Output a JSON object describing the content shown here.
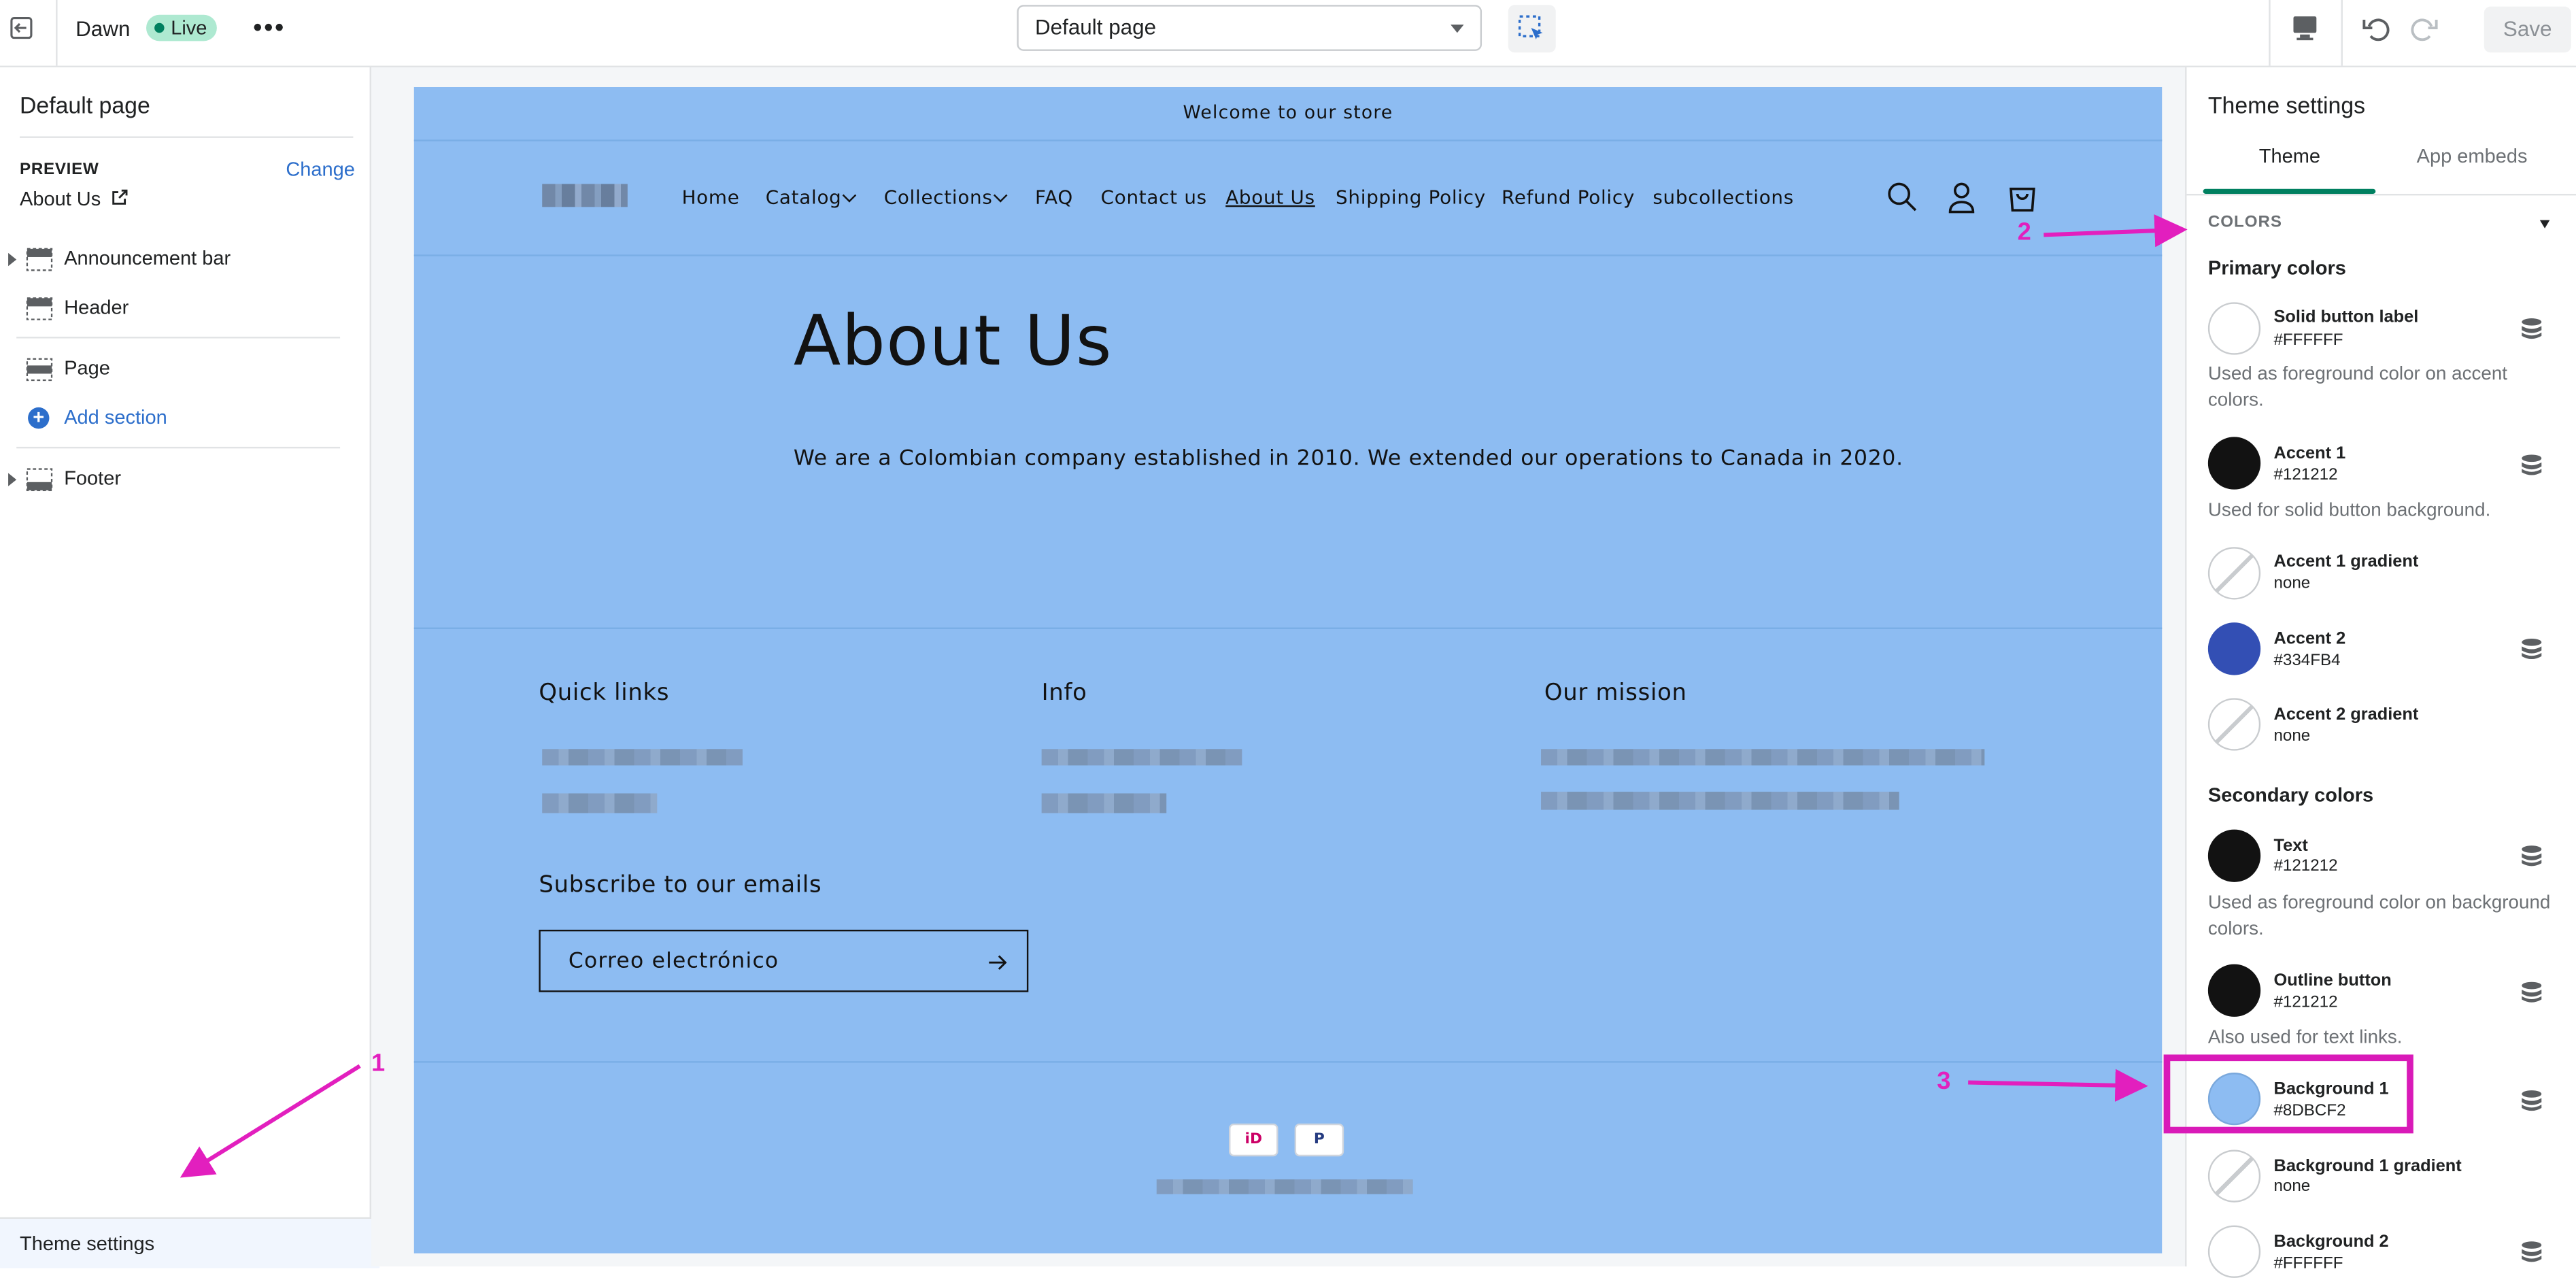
{
  "topbar": {
    "theme_name": "Dawn",
    "live_label": "Live",
    "page_select": "Default page",
    "save_label": "Save"
  },
  "left_panel": {
    "title": "Default page",
    "preview_label": "PREVIEW",
    "change_link": "Change",
    "preview_value": "About Us",
    "sections": {
      "announcement": "Announcement bar",
      "header": "Header",
      "page": "Page",
      "add_section": "Add section",
      "footer": "Footer"
    },
    "theme_settings": "Theme settings"
  },
  "store": {
    "announcement": "Welcome to our store",
    "nav": [
      "Home",
      "Catalog",
      "Collections",
      "FAQ",
      "Contact us",
      "About Us",
      "Shipping Policy",
      "Refund Policy",
      "subcollections"
    ],
    "page_title": "About Us",
    "page_text": "We are a Colombian company established in 2010. We extended our operations to Canada in 2020.",
    "footer": {
      "quick_links": "Quick links",
      "info": "Info",
      "mission": "Our mission",
      "subscribe": "Subscribe to our emails",
      "email_placeholder": "Correo electrónico"
    },
    "background_color": "#8DBCF2"
  },
  "right_panel": {
    "title": "Theme settings",
    "tabs": [
      "Theme",
      "App embeds"
    ],
    "section": "COLORS",
    "primary_title": "Primary colors",
    "secondary_title": "Secondary colors",
    "colors": [
      {
        "label": "Solid button label",
        "value": "#FFFFFF",
        "desc": "Used as foreground color on accent colors."
      },
      {
        "label": "Accent 1",
        "value": "#121212",
        "desc": "Used for solid button background."
      },
      {
        "label": "Accent 1 gradient",
        "value": "none"
      },
      {
        "label": "Accent 2",
        "value": "#334FB4"
      },
      {
        "label": "Accent 2 gradient",
        "value": "none"
      },
      {
        "label": "Text",
        "value": "#121212",
        "desc": "Used as foreground color on background colors."
      },
      {
        "label": "Outline button",
        "value": "#121212",
        "desc": "Also used for text links."
      },
      {
        "label": "Background 1",
        "value": "#8DBCF2"
      },
      {
        "label": "Background 1 gradient",
        "value": "none"
      },
      {
        "label": "Background 2",
        "value": "#FFFFFF"
      }
    ]
  },
  "annotations": [
    "1",
    "2",
    "3"
  ],
  "accent_color": "#e21fbe"
}
